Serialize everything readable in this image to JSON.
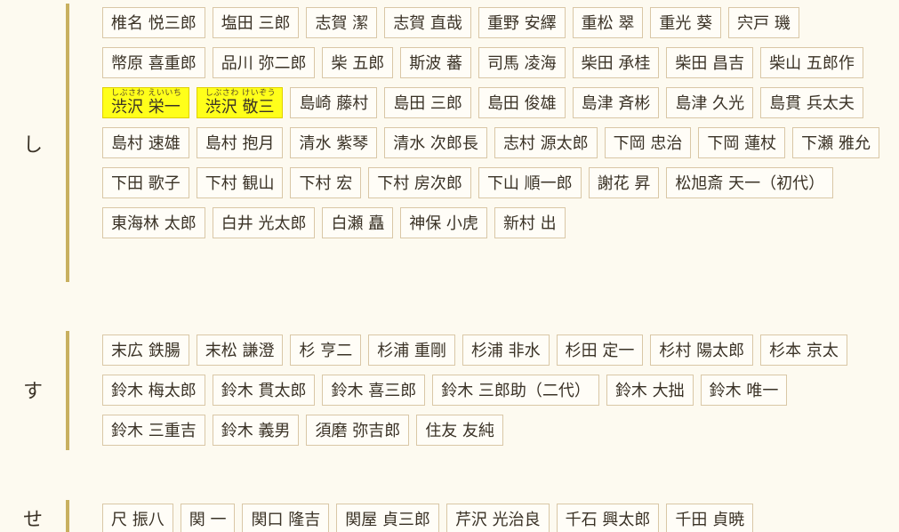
{
  "sections": [
    {
      "kana": "し",
      "names": [
        "椎名 悦三郎",
        "塩田 三郎",
        "志賀 潔",
        "志賀 直哉",
        "重野 安繹",
        "重松 翠",
        "重光 葵",
        "宍戸 璣",
        "幣原 喜重郎",
        "品川 弥二郎",
        "柴 五郎",
        "斯波 蕃",
        "司馬 凌海",
        "柴田 承桂",
        "柴田 昌吉",
        "柴山 五郎作",
        "渋沢 栄一",
        "渋沢 敬三",
        "島崎 藤村",
        "島田 三郎",
        "島田 俊雄",
        "島津 斉彬",
        "島津 久光",
        "島貫 兵太夫",
        "島村 速雄",
        "島村 抱月",
        "清水 紫琴",
        "清水 次郎長",
        "志村 源太郎",
        "下岡 忠治",
        "下岡 蓮杖",
        "下瀬 雅允",
        "下田 歌子",
        "下村 観山",
        "下村 宏",
        "下村 房次郎",
        "下山 順一郎",
        "謝花 昇",
        "松旭斎 天一（初代）",
        "東海林 太郎",
        "白井 光太郎",
        "白瀬 矗",
        "神保 小虎",
        "新村 出"
      ],
      "highlights": {
        "16": "しぶさわ えいいち",
        "17": "しぶさわ けいぞう"
      }
    },
    {
      "kana": "す",
      "names": [
        "末広 鉄腸",
        "末松 謙澄",
        "杉 亨二",
        "杉浦 重剛",
        "杉浦 非水",
        "杉田 定一",
        "杉村 陽太郎",
        "杉本 京太",
        "鈴木 梅太郎",
        "鈴木 貫太郎",
        "鈴木 喜三郎",
        "鈴木 三郎助（二代）",
        "鈴木 大拙",
        "鈴木 唯一",
        "鈴木 三重吉",
        "鈴木 義男",
        "須磨 弥吉郎",
        "住友 友純"
      ],
      "highlights": {}
    },
    {
      "kana": "せ",
      "names": [
        "尺 振八",
        "関 一",
        "関口 隆吉",
        "関屋 貞三郎",
        "芹沢 光治良",
        "千石 興太郎",
        "千田 貞暁"
      ],
      "highlights": {}
    }
  ]
}
